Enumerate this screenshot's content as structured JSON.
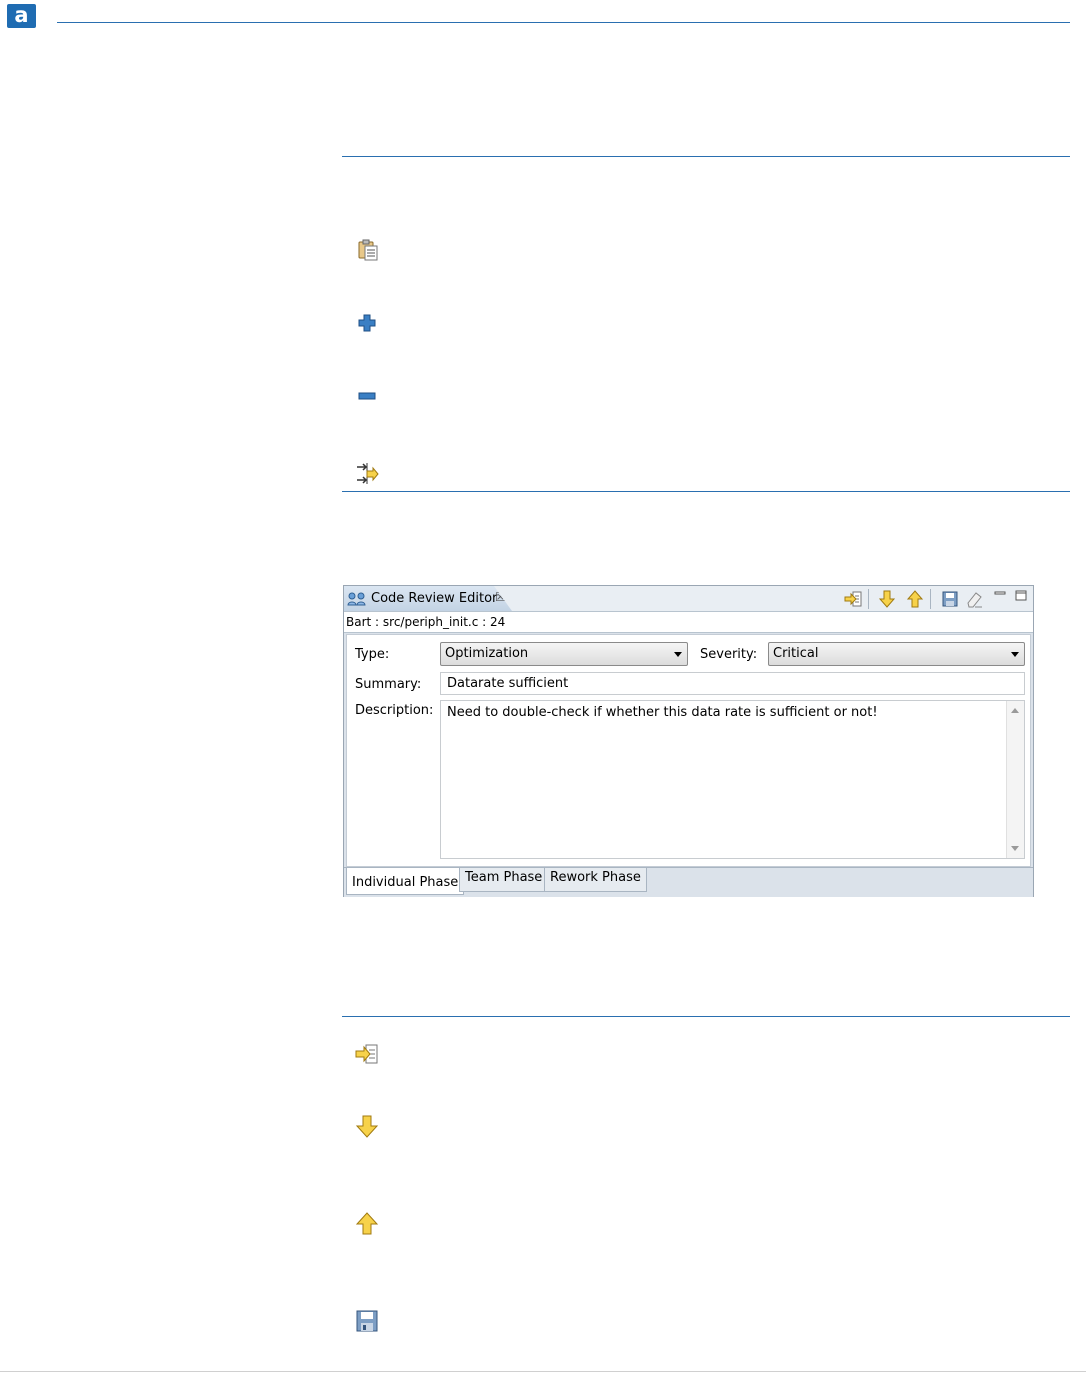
{
  "logo": {
    "letter": "a"
  },
  "editor": {
    "tab_title": "Code Review Editor",
    "tab_close": "☒",
    "location": "Bart : src/periph_init.c : 24",
    "type_label": "Type:",
    "type_value": "Optimization",
    "severity_label": "Severity:",
    "severity_value": "Critical",
    "summary_label": "Summary:",
    "summary_value": "Datarate sufficient",
    "description_label": "Description:",
    "description_value": "Need to double-check if whether this data rate is sufficient or not!",
    "bottom_tabs": [
      "Individual Phase",
      "Team Phase",
      "Rework Phase"
    ],
    "toolbar_icons": [
      "goto-icon",
      "next-arrow-icon",
      "previous-arrow-icon",
      "save-icon",
      "eraser-icon"
    ]
  },
  "doc_icons": {
    "section1": [
      "clipboard-icon",
      "plus-icon",
      "minus-icon",
      "merge-arrows-icon"
    ],
    "section2": [
      "goto-icon",
      "down-arrow-icon",
      "up-arrow-icon",
      "save-icon"
    ]
  },
  "colors": {
    "brand_blue": "#1f6cb2",
    "rule_blue": "#2a6fb0",
    "arrow_yellow": "#f7d24a"
  }
}
